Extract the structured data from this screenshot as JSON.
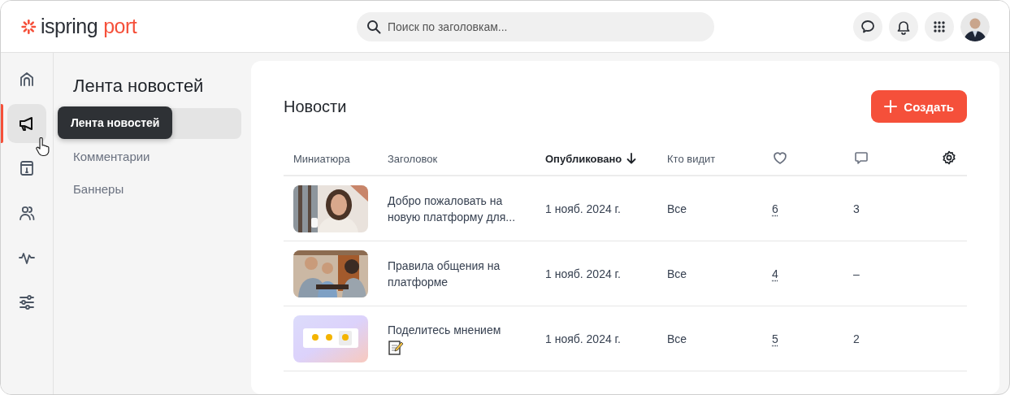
{
  "header": {
    "logo": {
      "brand": "ispring",
      "product": "port"
    },
    "search": {
      "placeholder": "Поиск по заголовкам..."
    },
    "actions": [
      {
        "kind": "chat"
      },
      {
        "kind": "bell"
      },
      {
        "kind": "apps"
      },
      {
        "kind": "avatar"
      }
    ]
  },
  "rail": [
    {
      "kind": "home",
      "selected": false
    },
    {
      "kind": "megaphone",
      "selected": true
    },
    {
      "kind": "info",
      "selected": false
    },
    {
      "kind": "people",
      "selected": false
    },
    {
      "kind": "pulse",
      "selected": false
    },
    {
      "kind": "sliders",
      "selected": false
    }
  ],
  "tooltip": "Лента новостей",
  "sidebar": {
    "title": "Лента новостей",
    "items": [
      {
        "selected": true
      },
      {
        "label": "Комментарии",
        "selected": false
      },
      {
        "label": "Баннеры",
        "selected": false
      }
    ]
  },
  "main": {
    "title": "Новости",
    "create_button": "Создать",
    "table": {
      "columns": [
        {
          "kind": "text",
          "label": "Миниатюра",
          "sorted": false
        },
        {
          "kind": "text",
          "label": "Заголовок",
          "sorted": false
        },
        {
          "kind": "text",
          "label": "Опубликовано",
          "sorted": true
        },
        {
          "kind": "text",
          "label": "Кто видит",
          "sorted": false
        },
        {
          "kind": "heart"
        },
        {
          "kind": "comment"
        },
        {
          "kind": "settings"
        }
      ],
      "rows": [
        {
          "title": "Добро пожаловать на новую платформу для...",
          "memo_icon": false,
          "published": "1 нояб. 2024 г.",
          "audience": "Все",
          "likes": "6",
          "comments": "3"
        },
        {
          "title": "Правила общения на платформе",
          "memo_icon": false,
          "published": "1 нояб. 2024 г.",
          "audience": "Все",
          "likes": "4",
          "comments": "–"
        },
        {
          "title": "Поделитесь мнением",
          "memo_icon": true,
          "published": "1 нояб. 2024 г.",
          "audience": "Все",
          "likes": "5",
          "comments": "2"
        }
      ]
    }
  }
}
